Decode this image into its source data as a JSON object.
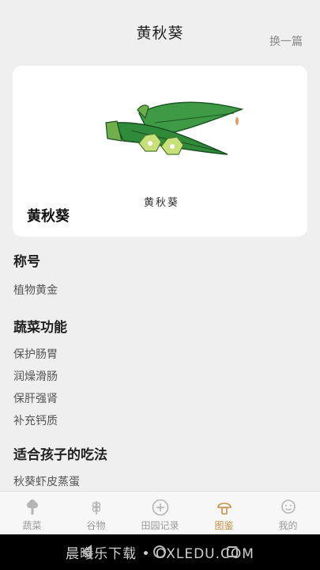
{
  "header": {
    "title": "黄秋葵",
    "switch_label": "换一篇"
  },
  "card": {
    "name": "黄秋葵",
    "handwritten": "黄秋葵"
  },
  "sections": [
    {
      "title": "称号",
      "items": [
        "植物黄金"
      ]
    },
    {
      "title": "蔬菜功能",
      "items": [
        "保护肠胃",
        "润燥滑肠",
        "保肝强肾",
        "补充钙质"
      ]
    },
    {
      "title": "适合孩子的吃法",
      "items": [
        "秋葵虾皮蒸蛋"
      ]
    }
  ],
  "tabbar": {
    "tabs": [
      {
        "label": "蔬菜",
        "icon": "broccoli-icon",
        "active": false
      },
      {
        "label": "谷物",
        "icon": "wheat-icon",
        "active": false
      },
      {
        "label": "田园记录",
        "icon": "plus-circle-icon",
        "active": false
      },
      {
        "label": "图鉴",
        "icon": "mushroom-icon",
        "active": true
      },
      {
        "label": "我的",
        "icon": "smiley-icon",
        "active": false
      }
    ]
  },
  "navbar": {
    "watermark": "晨曦乐下载 • OXLEDU.COM"
  },
  "colors": {
    "accent": "#c89043",
    "inactive": "#9a9a9a",
    "okra": "#2f8a3a"
  }
}
